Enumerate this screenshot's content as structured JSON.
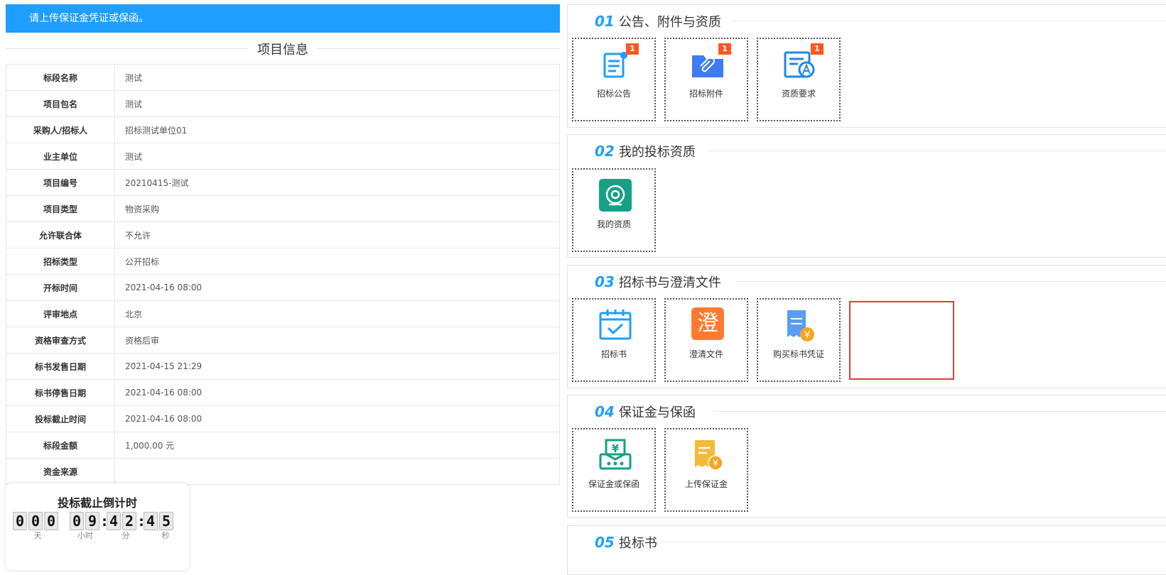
{
  "banner": {
    "text": "请上传保证金凭证或保函。"
  },
  "project_info": {
    "title": "项目信息",
    "rows": [
      {
        "label": "标段名称",
        "value": "测试"
      },
      {
        "label": "项目包名",
        "value": "测试"
      },
      {
        "label": "采购人/招标人",
        "value": "招标测试单位01"
      },
      {
        "label": "业主单位",
        "value": "测试"
      },
      {
        "label": "项目编号",
        "value": "20210415-测试"
      },
      {
        "label": "项目类型",
        "value": "物资采购"
      },
      {
        "label": "允许联合体",
        "value": "不允许"
      },
      {
        "label": "招标类型",
        "value": "公开招标"
      },
      {
        "label": "开标时间",
        "value": "2021-04-16 08:00"
      },
      {
        "label": "评审地点",
        "value": "北京"
      },
      {
        "label": "资格审查方式",
        "value": "资格后审"
      },
      {
        "label": "标书发售日期",
        "value": "2021-04-15 21:29"
      },
      {
        "label": "标书停售日期",
        "value": "2021-04-16 08:00"
      },
      {
        "label": "投标截止时间",
        "value": "2021-04-16 08:00"
      },
      {
        "label": "标段金额",
        "value": "1,000.00 元"
      },
      {
        "label": "资金来源",
        "value": ""
      }
    ]
  },
  "countdown": {
    "title": "投标截止倒计时",
    "days": [
      "0",
      "0",
      "0"
    ],
    "hours": [
      "0",
      "9"
    ],
    "minutes": [
      "4",
      "2"
    ],
    "seconds": [
      "4",
      "5"
    ],
    "units": {
      "days": "天",
      "hours": "小时",
      "minutes": "分",
      "seconds": "秒"
    },
    "separator": ":"
  },
  "sections": [
    {
      "num": "01",
      "title": "公告、附件与资质",
      "items": [
        {
          "label": "招标公告",
          "icon": "announcement-icon",
          "badge": "1",
          "color": "#1e9fff"
        },
        {
          "label": "招标附件",
          "icon": "attachment-folder-icon",
          "badge": "1",
          "color": "#3d7cf5"
        },
        {
          "label": "资质要求",
          "icon": "qualification-icon",
          "badge": "1",
          "color": "#1e88e5"
        }
      ]
    },
    {
      "num": "02",
      "title": "我的投标资质",
      "items": [
        {
          "label": "我的资质",
          "icon": "qualification-target-icon",
          "badge": "",
          "color": "#16a085"
        }
      ]
    },
    {
      "num": "03",
      "title": "招标书与澄清文件",
      "items": [
        {
          "label": "招标书",
          "icon": "calendar-check-icon",
          "badge": "",
          "color": "#1e9fff"
        },
        {
          "label": "澄清文件",
          "icon": "clarify-icon",
          "badge": "",
          "color": "#ff7a2f",
          "glyph": "澄"
        },
        {
          "label": "购买标书凭证",
          "icon": "receipt-yuan-icon",
          "badge": "",
          "color": "#5b9cf6"
        }
      ]
    },
    {
      "num": "04",
      "title": "保证金与保函",
      "items": [
        {
          "label": "保证金或保函",
          "icon": "deposit-yuan-icon",
          "badge": "",
          "color": "#16a085"
        },
        {
          "label": "上传保证金",
          "icon": "upload-deposit-icon",
          "badge": "",
          "color": "#f5b93a"
        }
      ]
    },
    {
      "num": "05",
      "title": "投标书",
      "items": []
    }
  ],
  "colors": {
    "accent": "#1e9fff",
    "badge": "#ff5722",
    "highlight": "#e53935"
  }
}
